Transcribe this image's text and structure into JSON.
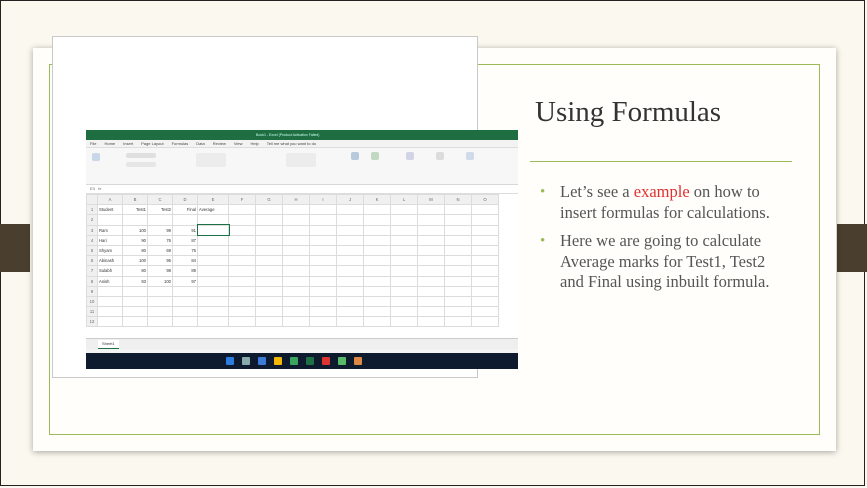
{
  "slide": {
    "title": "Using Formulas",
    "bullets": [
      {
        "pre": "Let’s see a ",
        "highlight": "example",
        "post": " on how to insert formulas for calculations."
      },
      {
        "pre": "Here we are going to calculate Average marks for Test1, Test2 and Final using inbuilt formula.",
        "highlight": "",
        "post": ""
      }
    ]
  },
  "excel": {
    "window_title": "Book1 - Excel (Product Activation Failed)",
    "menu": [
      "File",
      "Home",
      "Insert",
      "Page Layout",
      "Formulas",
      "Data",
      "Review",
      "View",
      "Help"
    ],
    "search_placeholder": "Tell me what you want to do",
    "columns": [
      "A",
      "B",
      "C",
      "D",
      "E",
      "F",
      "G",
      "H",
      "I",
      "J",
      "K",
      "L",
      "M",
      "N",
      "O"
    ],
    "headers": [
      "Student",
      "Test1",
      "Test2",
      "Final",
      "Average"
    ],
    "rows": [
      {
        "n": "1",
        "cells": [
          "Student",
          "Test1",
          "Test2",
          "Final",
          "Average"
        ]
      },
      {
        "n": "2",
        "cells": [
          "",
          "",
          "",
          "",
          ""
        ]
      },
      {
        "n": "3",
        "cells": [
          "Ram",
          "100",
          "99",
          "91",
          ""
        ]
      },
      {
        "n": "4",
        "cells": [
          "Hari",
          "90",
          "76",
          "87",
          ""
        ]
      },
      {
        "n": "5",
        "cells": [
          "Shyam",
          "80",
          "69",
          "75",
          ""
        ]
      },
      {
        "n": "6",
        "cells": [
          "Abinash",
          "100",
          "95",
          "84",
          ""
        ]
      },
      {
        "n": "7",
        "cells": [
          "Sulabh",
          "80",
          "98",
          "89",
          ""
        ]
      },
      {
        "n": "8",
        "cells": [
          "Anish",
          "93",
          "100",
          "97",
          ""
        ]
      },
      {
        "n": "9",
        "cells": [
          "",
          "",
          "",
          "",
          ""
        ]
      },
      {
        "n": "10",
        "cells": [
          "",
          "",
          "",
          "",
          ""
        ]
      },
      {
        "n": "11",
        "cells": [
          "",
          "",
          "",
          "",
          ""
        ]
      },
      {
        "n": "12",
        "cells": [
          "",
          "",
          "",
          "",
          ""
        ]
      }
    ],
    "sheet_tab": "Sheet1"
  }
}
